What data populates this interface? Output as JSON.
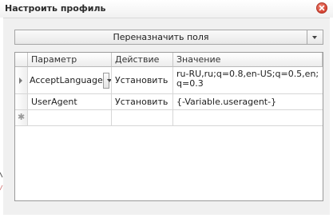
{
  "window": {
    "title": "Настроить профиль"
  },
  "toolbar": {
    "reassign_label": "Переназначить поля"
  },
  "grid": {
    "columns": [
      "Параметр",
      "Действие",
      "Значение"
    ],
    "rows": [
      {
        "parameter": "AcceptLanguage",
        "action": "Установить",
        "value": "ru-RU,ru;q=0.8,en-US;q=0.5,en;q=0.3"
      },
      {
        "parameter": "UserAgent",
        "action": "Установить",
        "value": "{-Variable.useragent-}"
      }
    ]
  }
}
